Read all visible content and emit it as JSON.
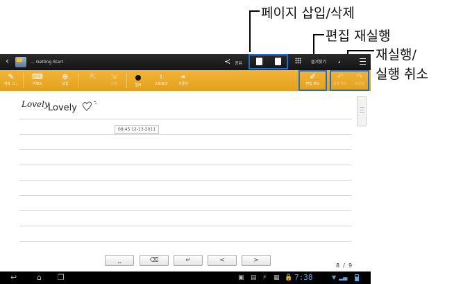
{
  "callouts": {
    "insert_delete_page": "페이지 삽입/삭제",
    "redo_edit": "편집 재실행",
    "redo_undo_line1": "재실행/",
    "redo_undo_line2": "실행 취소"
  },
  "titlebar": {
    "notebook_title": "Getting Start",
    "share_label": "공유",
    "bookmark_label": "즐겨찾기"
  },
  "toolbar": {
    "tools": [
      {
        "icon": "handwrite-icon",
        "label": "자유 그..."
      },
      {
        "icon": "keyboard-icon",
        "label": "키보드"
      },
      {
        "icon": "insert-icon",
        "label": "삽입"
      },
      {
        "icon": "select-icon",
        "label": ""
      },
      {
        "icon": "select-icon",
        "label": "선택"
      },
      {
        "icon": "color-icon",
        "label": "컬러"
      },
      {
        "icon": "stroke-icon",
        "label": "스트로크"
      },
      {
        "icon": "baseline-icon",
        "label": "기준선"
      }
    ],
    "stroke_value": "1",
    "edit_redo_label": "편집 모드",
    "undo_label": "실행 취소",
    "redo_label": "재실행",
    "accent_color": "#e9a62a"
  },
  "note": {
    "handwriting": "Lovely",
    "typed": "Lovely",
    "timestamp": "08:45 12-13-2011",
    "page_indicator": "8  /  9"
  },
  "keys": {
    "space": "⎵",
    "backspace": "⌫",
    "enter": "↵",
    "left": "<",
    "right": ">"
  },
  "statusbar": {
    "time": "7:38"
  }
}
